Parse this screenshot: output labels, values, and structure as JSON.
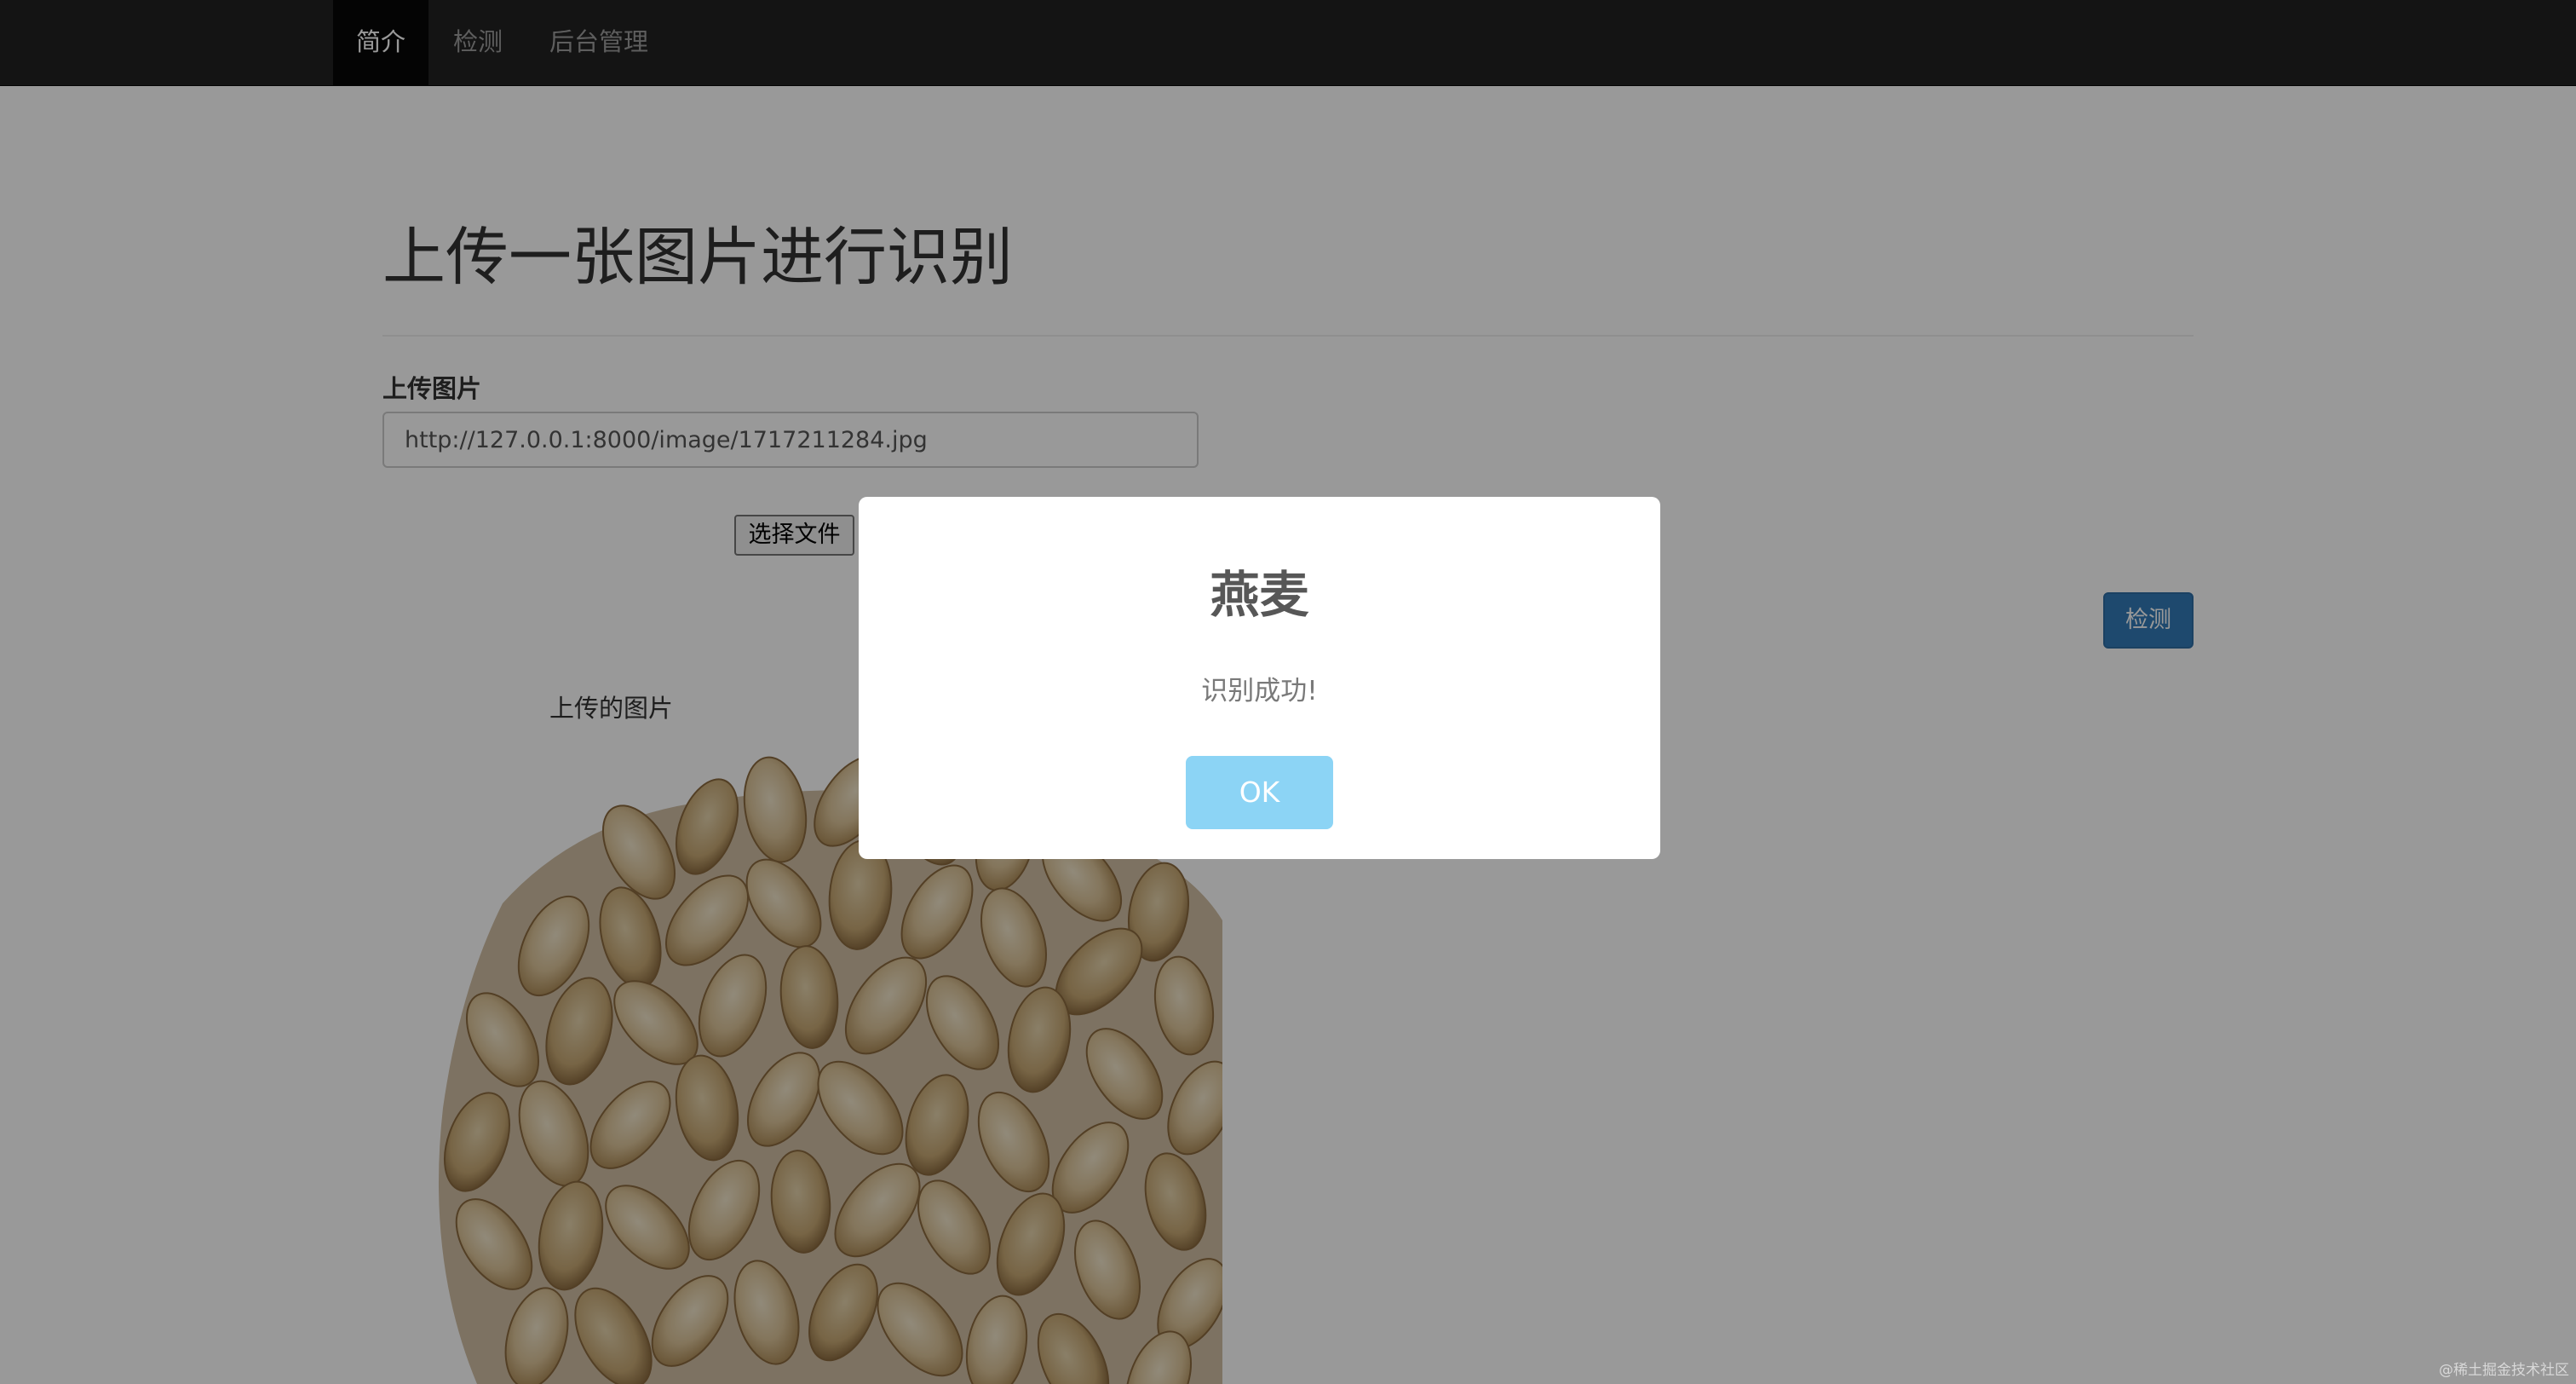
{
  "navbar": {
    "items": [
      {
        "label": "简介",
        "active": true
      },
      {
        "label": "检测",
        "active": false
      },
      {
        "label": "后台管理",
        "active": false
      }
    ]
  },
  "main": {
    "title": "上传一张图片进行识别",
    "upload_label": "上传图片",
    "url_value": "http://127.0.0.1:8000/image/1717211284.jpg",
    "file_button_label": "选择文件",
    "detect_button_label": "检测",
    "image_caption": "上传的图片"
  },
  "modal": {
    "title": "燕麦",
    "message": "识别成功!",
    "ok_label": "OK"
  },
  "watermark": "@稀土掘金技术社区",
  "colors": {
    "navbar_bg": "#222222",
    "navbar_active_bg": "#080808",
    "primary_button": "#337ab7",
    "modal_ok_button": "#8cd4f5",
    "overlay": "rgba(0,0,0,0.4)"
  }
}
